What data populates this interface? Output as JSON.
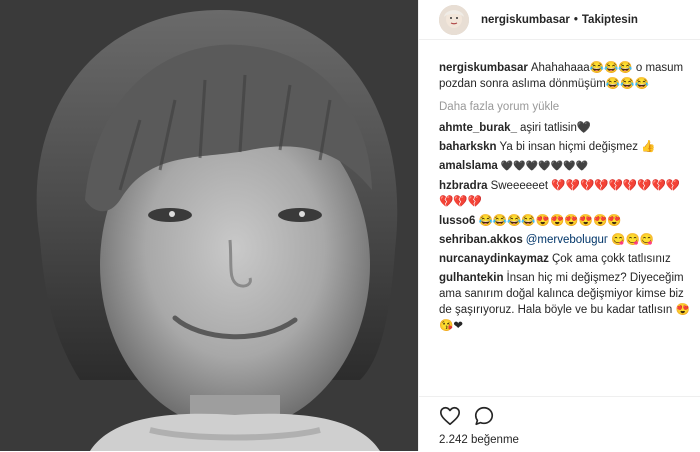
{
  "header": {
    "username": "nergiskumbasar",
    "separator": "•",
    "follow_status": "Takiptesin"
  },
  "caption": {
    "user": "nergiskumbasar",
    "text": "Ahahahaaa😂😂😂 o masum pozdan sonra aslıma dönmüşüm😂😂😂"
  },
  "load_more": "Daha fazla yorum yükle",
  "comments": [
    {
      "user": "ahmte_burak_",
      "text": "aşiri tatlisin🖤"
    },
    {
      "user": "baharkskn",
      "text": "Ya bi insan hiçmi değişmez 👍"
    },
    {
      "user": "amalslama",
      "text": "🖤🖤🖤🖤🖤🖤🖤"
    },
    {
      "user": "hzbradra",
      "text": "Sweeeeeet 💔💔💔💔💔💔💔💔💔💔💔💔"
    },
    {
      "user": "lusso6",
      "text": "😂😂😂😂😍😍😍😍😍😍"
    },
    {
      "user": "sehriban.akkos",
      "mention": "@merveboluguг",
      "text": "😋😋😋"
    },
    {
      "user": "nurcanaydinkaymaz",
      "text": "Çok ama çokk tatlısınız"
    },
    {
      "user": "gulhantekin",
      "text": "İnsan hiç mi değişmez? Diyeceğim ama sanırım doğal kalınca değişmiyor kimse biz de şaşırıyoruz. Hala böyle ve bu kadar tatlısın 😍😘❤"
    }
  ],
  "actions": {
    "likes": "2.242 beğenme"
  },
  "icons": {
    "like": "heart-outline-icon",
    "comment": "comment-bubble-icon"
  }
}
